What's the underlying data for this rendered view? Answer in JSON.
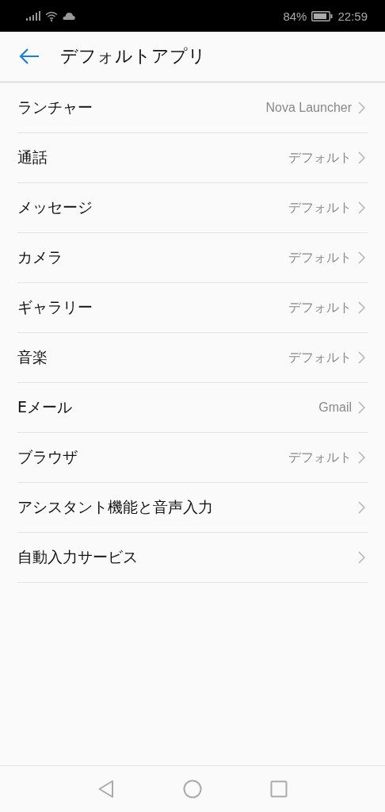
{
  "status_bar": {
    "battery": "84%",
    "time": "22:59"
  },
  "header": {
    "title": "デフォルトアプリ"
  },
  "items": [
    {
      "label": "ランチャー",
      "value": "Nova Launcher"
    },
    {
      "label": "通話",
      "value": "デフォルト"
    },
    {
      "label": "メッセージ",
      "value": "デフォルト"
    },
    {
      "label": "カメラ",
      "value": "デフォルト"
    },
    {
      "label": "ギャラリー",
      "value": "デフォルト"
    },
    {
      "label": "音楽",
      "value": "デフォルト"
    },
    {
      "label": "Eメール",
      "value": "Gmail"
    },
    {
      "label": "ブラウザ",
      "value": "デフォルト"
    },
    {
      "label": "アシスタント機能と音声入力"
    },
    {
      "label": "自動入力サービス"
    }
  ]
}
